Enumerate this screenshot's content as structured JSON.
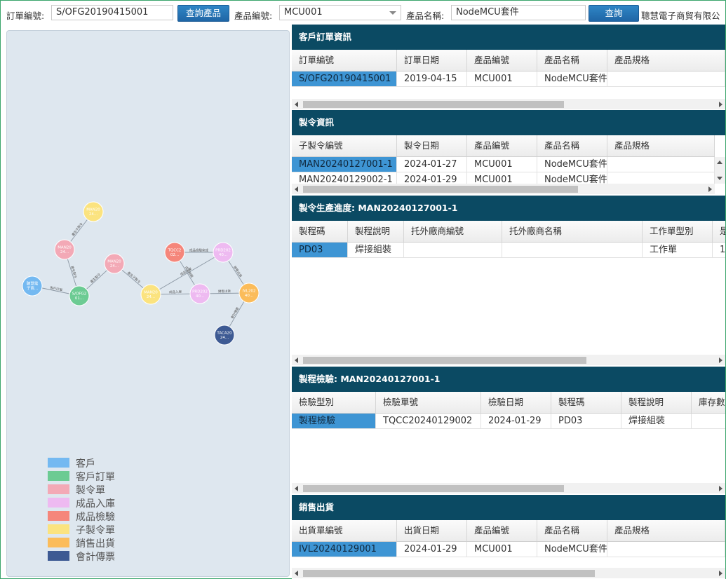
{
  "toolbar": {
    "order_label": "訂單編號:",
    "order_value": "S/OFG20190415001",
    "query_product_label": "查詢產品",
    "product_no_label": "產品編號:",
    "product_no_value": "MCU001",
    "product_name_label": "產品名稱:",
    "product_name_value": "NodeMCU套件",
    "query_label": "查詢",
    "company": "聰慧電子商貿有限公"
  },
  "graph": {
    "nodes": [
      {
        "id": "n1",
        "label1": "聰慧電",
        "label2": "子商...",
        "type": "customer"
      },
      {
        "id": "n2",
        "label1": "S/OFG2",
        "label2": "01...",
        "type": "order"
      },
      {
        "id": "n3",
        "label1": "MAN20",
        "label2": "24...",
        "type": "mo"
      },
      {
        "id": "n4",
        "label1": "MAN20",
        "label2": "24...",
        "type": "submo"
      },
      {
        "id": "n5",
        "label1": "MAN20",
        "label2": "24...",
        "type": "mo"
      },
      {
        "id": "n6",
        "label1": "MAN20",
        "label2": "24...",
        "type": "submo"
      },
      {
        "id": "n7",
        "label1": "TQCC2",
        "label2": "02...",
        "type": "inspect"
      },
      {
        "id": "n8",
        "label1": "PRD202",
        "label2": "40...",
        "type": "stock"
      },
      {
        "id": "n9",
        "label1": "PRD202",
        "label2": "40...",
        "type": "stock"
      },
      {
        "id": "n10",
        "label1": "IVL202",
        "label2": "40...",
        "type": "ship"
      },
      {
        "id": "n11",
        "label1": "TACA20",
        "label2": "24...",
        "type": "voucher"
      }
    ],
    "edges": [
      {
        "from": "n1",
        "to": "n2",
        "label": "客戶訂單"
      },
      {
        "from": "n2",
        "to": "n3",
        "label": "產生製令"
      },
      {
        "from": "n3",
        "to": "n4",
        "label": "產生子製令"
      },
      {
        "from": "n2",
        "to": "n5",
        "label": "產生製令"
      },
      {
        "from": "n5",
        "to": "n6",
        "label": "產生子製令"
      },
      {
        "from": "n6",
        "to": "n9",
        "label": "成品入庫"
      },
      {
        "from": "n6",
        "to": "n8",
        "label": "成品入庫"
      },
      {
        "from": "n7",
        "to": "n8",
        "label": "成品檢驗完成"
      },
      {
        "from": "n7",
        "to": "n9",
        "label": "成品檢驗"
      },
      {
        "from": "n9",
        "to": "n10",
        "label": "銷售出貨"
      },
      {
        "from": "n8",
        "to": "n10",
        "label": "銷售出貨"
      },
      {
        "from": "n10",
        "to": "n11",
        "label": "會計傳票"
      }
    ]
  },
  "colors": {
    "customer": "#74b9f1",
    "order": "#6ccb93",
    "mo": "#f3a9b6",
    "stock": "#eebaf1",
    "inspect": "#f5867b",
    "submo": "#fbe37f",
    "ship": "#fbbc5a",
    "voucher": "#3d5a93"
  },
  "legend": [
    {
      "label": "客戶",
      "type": "customer"
    },
    {
      "label": "客戶訂單",
      "type": "order"
    },
    {
      "label": "製令單",
      "type": "mo"
    },
    {
      "label": "成品入庫",
      "type": "stock"
    },
    {
      "label": "成品檢驗",
      "type": "inspect"
    },
    {
      "label": "子製令單",
      "type": "submo"
    },
    {
      "label": "銷售出貨",
      "type": "ship"
    },
    {
      "label": "會計傳票",
      "type": "voucher"
    }
  ],
  "customer_orders": {
    "title": "客戶訂單資訊",
    "columns": [
      "訂單編號",
      "訂單日期",
      "產品編號",
      "產品名稱",
      "產品規格"
    ],
    "rows": [
      [
        "S/OFG20190415001",
        "2019-04-15",
        "MCU001",
        "NodeMCU套件",
        ""
      ]
    ]
  },
  "mo_info": {
    "title": "製令資訊",
    "columns": [
      "子製令編號",
      "製令日期",
      "產品編號",
      "產品名稱",
      "產品規格"
    ],
    "rows": [
      [
        "MAN20240127001-1",
        "2024-01-27",
        "MCU001",
        "NodeMCU套件",
        ""
      ],
      [
        "MAN20240129002-1",
        "2024-01-29",
        "MCU001",
        "NodeMCU套件",
        ""
      ]
    ]
  },
  "mo_progress": {
    "title": "製令生產進度: MAN20240127001-1",
    "columns": [
      "製程碼",
      "製程說明",
      "托外廠商編號",
      "托外廠商名稱",
      "工作單型別",
      "是"
    ],
    "rows": [
      [
        "PD03",
        "焊接組裝",
        "",
        "",
        "工作單",
        "1"
      ]
    ]
  },
  "process_inspect": {
    "title": "製程檢驗: MAN20240127001-1",
    "columns": [
      "檢驗型別",
      "檢驗單號",
      "檢驗日期",
      "製程碼",
      "製程說明",
      "庫存數"
    ],
    "rows": [
      [
        "製程檢驗",
        "TQCC20240129002",
        "2024-01-29",
        "PD03",
        "焊接組裝",
        ""
      ]
    ]
  },
  "sales_ship": {
    "title": "銷售出貨",
    "columns": [
      "出貨單編號",
      "出貨日期",
      "產品編號",
      "產品名稱",
      "產品規格"
    ],
    "rows": [
      [
        "IVL20240129001",
        "2024-01-29",
        "MCU001",
        "NodeMCU套件",
        ""
      ]
    ]
  }
}
